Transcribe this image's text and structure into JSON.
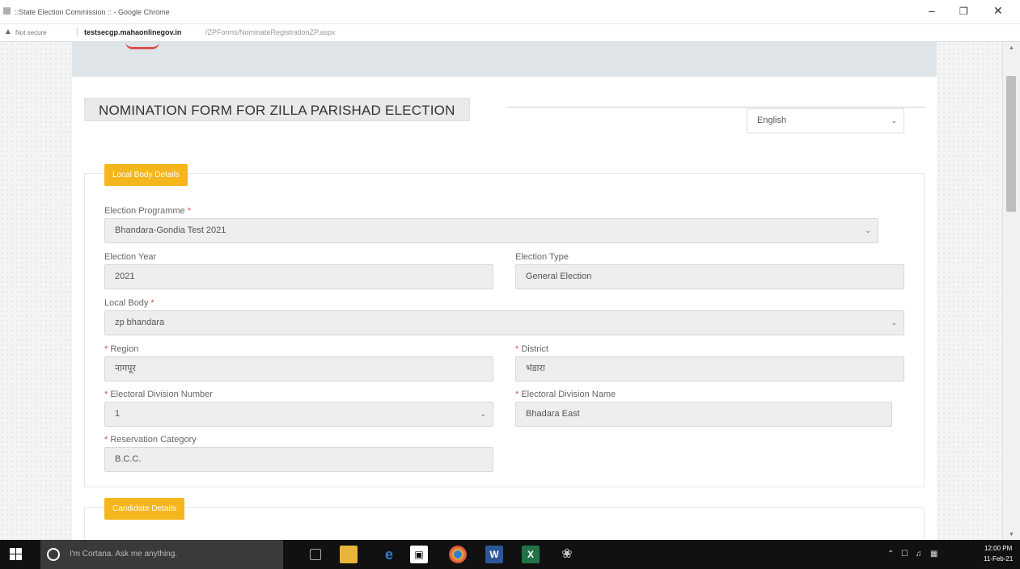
{
  "browser": {
    "window_title": "::State Election Commission :: - Google Chrome",
    "security_label": "Not secure",
    "url_host": "testsecgp.mahaonlinegov.in",
    "url_path": "/ZPForms/NominateRegistrationZP.aspx"
  },
  "form": {
    "title": "NOMINATION FORM FOR ZILLA PARISHAD ELECTION",
    "language": "English",
    "section_local_body": "Local Body Details",
    "section_candidate": "Candidate Details",
    "fields": {
      "election_programme": {
        "label": "Election Programme",
        "value": "Bhandara-Gondia Test 2021"
      },
      "election_year": {
        "label": "Election Year",
        "value": "2021"
      },
      "election_type": {
        "label": "Election Type",
        "value": "General Election"
      },
      "local_body": {
        "label": "Local Body",
        "value": "zp bhandara"
      },
      "region": {
        "label": "Region",
        "value": "नागपूर"
      },
      "district": {
        "label": "District",
        "value": "भंडारा"
      },
      "electoral_division_number": {
        "label": "Electoral Division Number",
        "value": "1"
      },
      "electoral_division_name": {
        "label": "Electoral Division Name",
        "value": "Bhadara East"
      },
      "reservation_category": {
        "label": "Reservation Category",
        "value": "B.C.C."
      }
    },
    "required_mark": "*"
  },
  "taskbar": {
    "cortana_placeholder": "I'm Cortana. Ask me anything.",
    "time": "12:00 PM",
    "date": "11-Feb-21"
  },
  "icons": {
    "chevron": "chevron-down-icon",
    "warning": "warning-triangle-icon"
  }
}
